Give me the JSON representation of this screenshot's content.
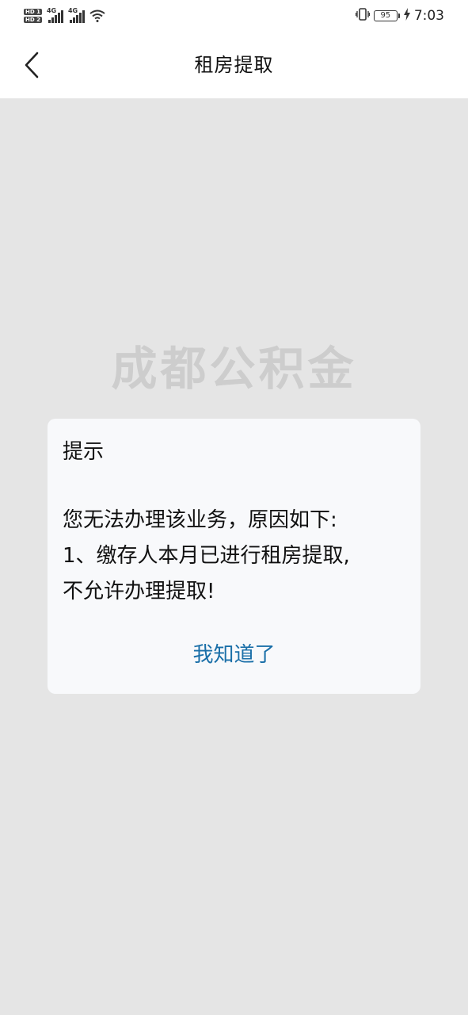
{
  "status_bar": {
    "sim1_tag": "HD 1",
    "sim2_tag": "HD 2",
    "net1": "4G",
    "net2": "4G",
    "battery": "95",
    "time": "7:03"
  },
  "nav": {
    "title": "租房提取",
    "back_icon": "chevron-left-icon"
  },
  "watermark": {
    "text": "成都公积金"
  },
  "dialog": {
    "title": "提示",
    "message_lines": [
      "您无法办理该业务，原因如下:",
      "1、缴存人本月已进行租房提取,",
      "不允许办理提取!"
    ],
    "confirm_label": "我知道了"
  },
  "colors": {
    "accent": "#1a6fa8",
    "background": "#e5e5e5",
    "dialog_bg": "#f8f9fb",
    "header_bg": "#ffffff"
  }
}
